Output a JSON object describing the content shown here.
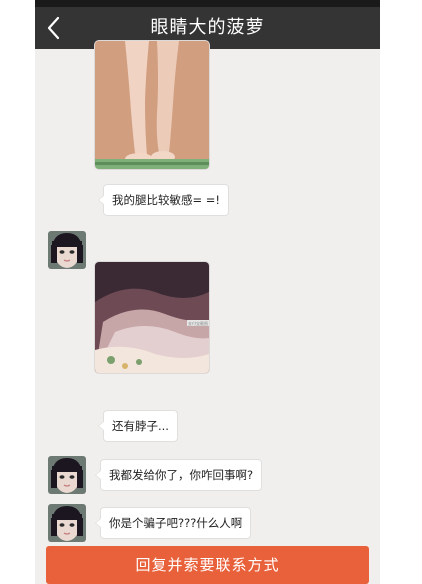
{
  "header": {
    "title": "眼睛大的菠萝",
    "back_icon": "chevron-left-icon"
  },
  "messages": [
    {
      "type": "image",
      "description": "photo-legs"
    },
    {
      "type": "text",
      "text": "我的腿比较敏感= =!"
    },
    {
      "type": "image",
      "description": "photo-neck"
    },
    {
      "type": "text",
      "text": "还有脖子..."
    },
    {
      "type": "text",
      "text": "我都发给你了，你咋回事啊?"
    },
    {
      "type": "text",
      "text": "你是个骗子吧???什么人啊"
    }
  ],
  "watermark": "支付宝截图",
  "footer": {
    "reply_label": "回复并索要联系方式"
  },
  "colors": {
    "header_bg": "#343434",
    "chat_bg": "#f1efed",
    "button_bg": "#e8613a"
  }
}
